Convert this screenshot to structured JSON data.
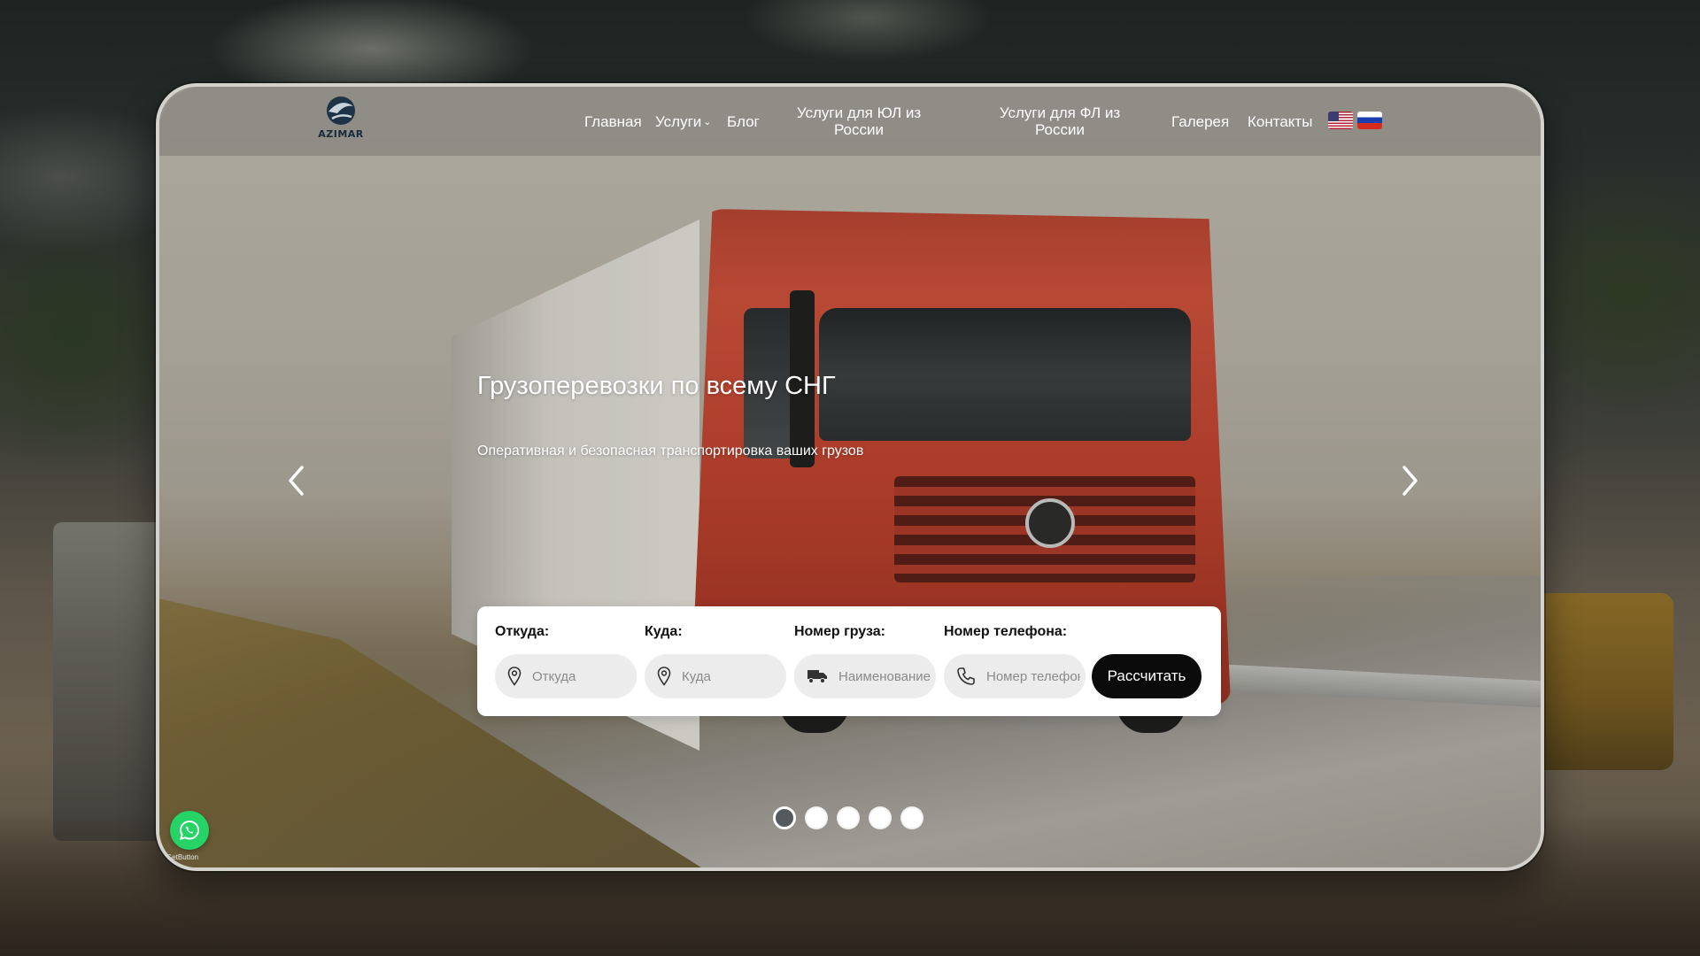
{
  "brand": {
    "logo_text": "AZIMAR"
  },
  "nav": {
    "home": "Главная",
    "services": "Услуги",
    "blog": "Блог",
    "legal_services": "Услуги для ЮЛ из России",
    "individual_services": "Услуги для ФЛ из России",
    "gallery": "Галерея",
    "contacts": "Контакты"
  },
  "languages": [
    "en",
    "ru"
  ],
  "hero": {
    "title": "Грузоперевозки по всему СНГ",
    "subtitle": "Оперативная и безопасная транспортировка ваших грузов"
  },
  "form": {
    "from_label": "Откуда:",
    "from_placeholder": "Откуда",
    "to_label": "Куда:",
    "to_placeholder": "Куда",
    "cargo_label": "Номер груза:",
    "cargo_placeholder": "Наименование груза",
    "phone_label": "Номер телефона:",
    "phone_placeholder": "Номер телефона",
    "submit_label": "Рассчитать"
  },
  "slider": {
    "total": 5,
    "active": 1
  },
  "widget": {
    "caption": "GetButton"
  },
  "colors": {
    "header_bg": "#787873",
    "button_bg": "#0b0b0b",
    "whatsapp": "#25d366"
  }
}
